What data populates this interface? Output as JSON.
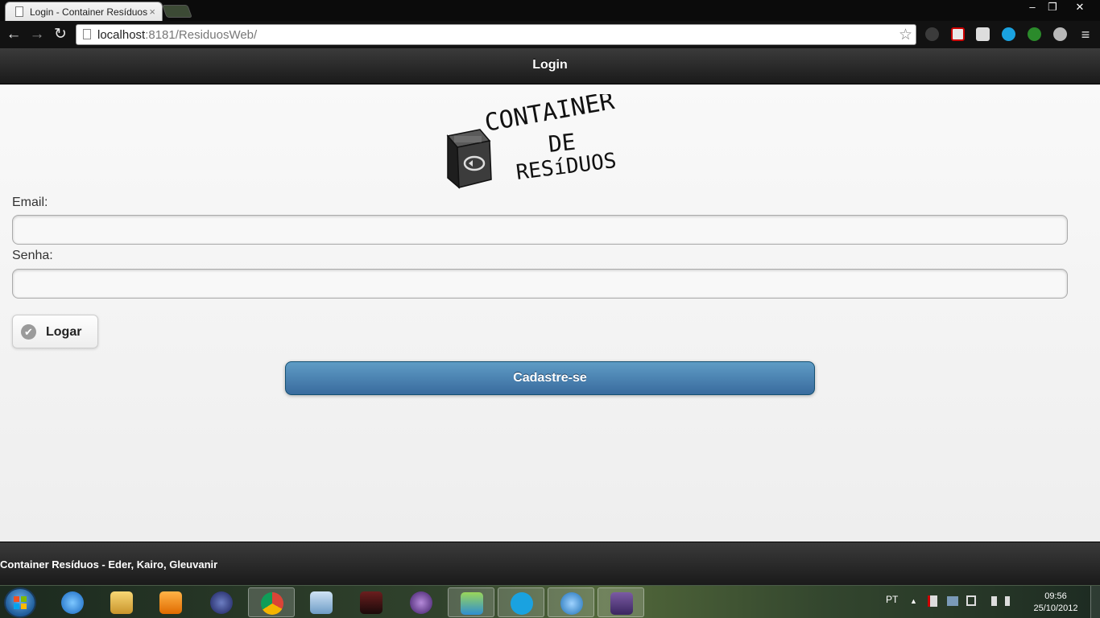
{
  "browser": {
    "tab_title": "Login - Container Resíduos",
    "tab_close": "×",
    "url_host": "localhost",
    "url_rest": ":8181/ResiduosWeb/",
    "window_controls": {
      "minimize": "–",
      "restore": "❐",
      "close": "✕"
    },
    "nav": {
      "back": "←",
      "forward": "→",
      "reload": "↻"
    },
    "bookmark_star": "☆",
    "menu": "≡"
  },
  "page": {
    "header_title": "Login",
    "logo_alt": "Container de Resíduos",
    "logo_text": [
      "CONTAINER",
      "DE",
      "RESíDUOS"
    ],
    "form": {
      "email_label": "Email:",
      "email_value": "",
      "senha_label": "Senha:",
      "senha_value": "",
      "logar_label": "Logar",
      "logar_icon": "✔",
      "cadastre_label": "Cadastre-se"
    },
    "footer_text": "Container Resíduos - Eder, Kairo, Gleuvanir"
  },
  "taskbar": {
    "items": [
      "internet-explorer",
      "windows-explorer",
      "media-player",
      "eclipse",
      "chrome",
      "virtualbox",
      "game",
      "eclipse-purple",
      "messenger",
      "skype",
      "app",
      "java-ee-ide"
    ],
    "tray_language": "PT",
    "tray_arrow": "▲",
    "clock_time": "09:56",
    "clock_date": "25/10/2012"
  },
  "colors": {
    "header_bg": "#1a1a1a",
    "button_blue": "#4a83b4",
    "page_bg": "#f3f3f3"
  }
}
